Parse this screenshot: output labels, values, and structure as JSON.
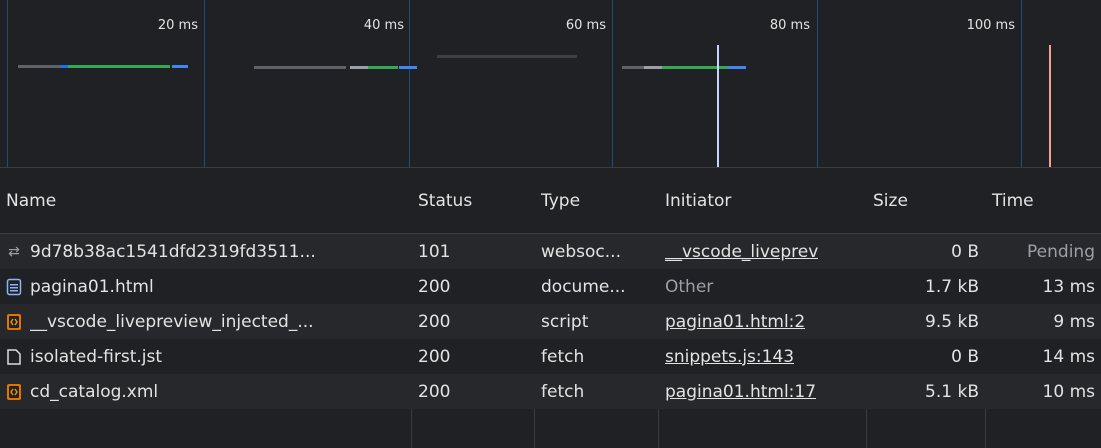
{
  "timeline": {
    "ticks": [
      "20 ms",
      "40 ms",
      "60 ms",
      "80 ms",
      "100 ms"
    ]
  },
  "columns": {
    "name": "Name",
    "status": "Status",
    "type": "Type",
    "initiator": "Initiator",
    "size": "Size",
    "time": "Time"
  },
  "rows": [
    {
      "icon": "websocket-icon",
      "name": "9d78b38ac1541dfd2319fd3511...",
      "status": "101",
      "type": "websoc...",
      "initiator": "__vscode_liveprev",
      "initiator_link": true,
      "size": "0 B",
      "time": "Pending"
    },
    {
      "icon": "document-icon",
      "name": "pagina01.html",
      "status": "200",
      "type": "docume...",
      "initiator": "Other",
      "initiator_link": false,
      "size": "1.7 kB",
      "time": "13 ms"
    },
    {
      "icon": "script-icon",
      "name": "__vscode_livepreview_injected_...",
      "status": "200",
      "type": "script",
      "initiator": "pagina01.html:2",
      "initiator_link": true,
      "size": "9.5 kB",
      "time": "9 ms"
    },
    {
      "icon": "file-icon",
      "name": "isolated-first.jst",
      "status": "200",
      "type": "fetch",
      "initiator": "snippets.js:143",
      "initiator_link": true,
      "size": "0 B",
      "time": "14 ms"
    },
    {
      "icon": "xml-icon",
      "name": "cd_catalog.xml",
      "status": "200",
      "type": "fetch",
      "initiator": "pagina01.html:17",
      "initiator_link": true,
      "size": "5.1 kB",
      "time": "10 ms"
    }
  ],
  "colors": {
    "background": "#202124",
    "grid": "#1f4d78",
    "waiting": "#9aa0a6",
    "download": "#34a853",
    "content": "#4285f4",
    "dom_content_loaded": "#c8d4ff",
    "load": "#f5a08c"
  }
}
